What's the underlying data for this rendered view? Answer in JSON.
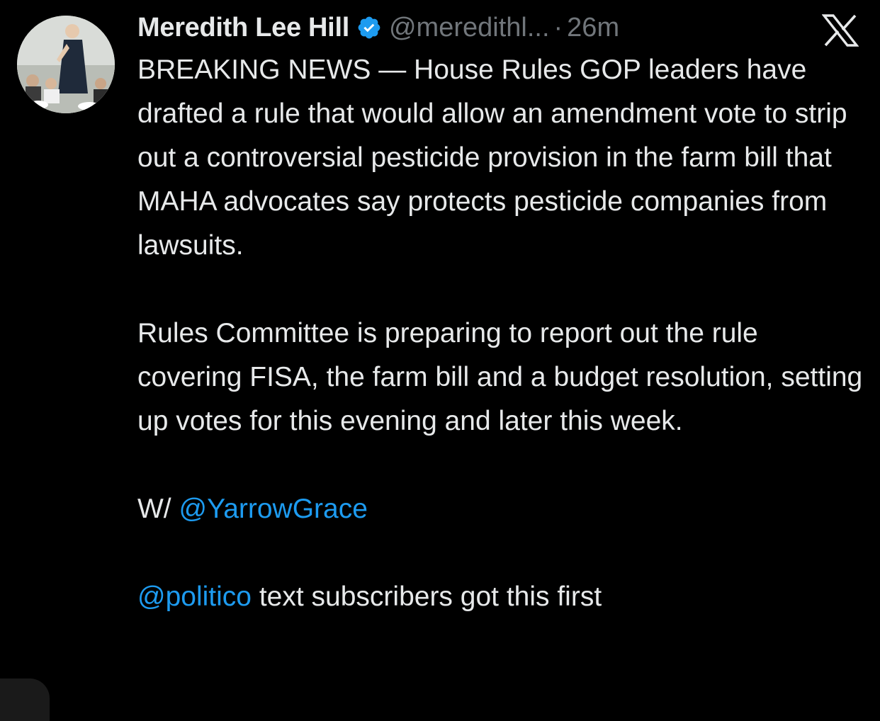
{
  "author": {
    "display_name": "Meredith Lee Hill",
    "handle": "@meredithl...",
    "separator": "·",
    "time": "26m"
  },
  "tweet": {
    "paragraphs": [
      "BREAKING NEWS — House Rules GOP leaders have drafted a rule that would allow an amendment vote to strip out a controversial pesticide provision in the farm bill that MAHA advocates say protects pesticide companies from lawsuits.",
      "Rules Committee is preparing to report out the rule covering FISA, the farm bill and a budget resolution, setting up votes for this evening and later this week."
    ],
    "with_prefix": "W/ ",
    "with_mention": "@YarrowGrace",
    "footer_mention": "@politico",
    "footer_text": " text subscribers got this first"
  },
  "icons": {
    "verified": "verified-badge-icon",
    "brand": "x-logo-icon"
  },
  "colors": {
    "background": "#000000",
    "text": "#e7e9ea",
    "muted": "#71767b",
    "accent": "#1d9bf0"
  }
}
